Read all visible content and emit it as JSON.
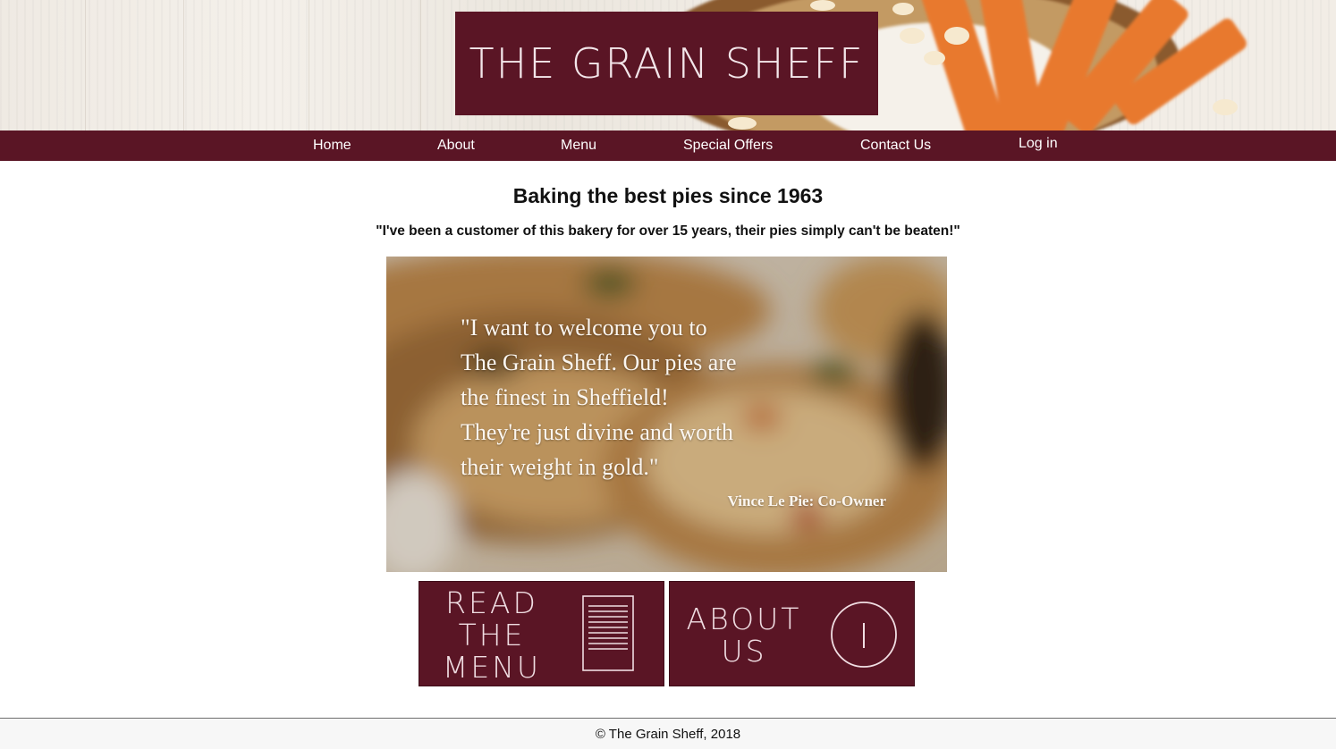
{
  "header": {
    "logo_text": "The Grain Sheff"
  },
  "nav": {
    "items": [
      {
        "label": "Home"
      },
      {
        "label": "About"
      },
      {
        "label": "Menu"
      },
      {
        "label": "Special Offers"
      },
      {
        "label": "Contact Us"
      },
      {
        "label": "Log in"
      }
    ]
  },
  "main": {
    "headline": "Baking the best pies since 1963",
    "testimonial": "\"I've been a customer of this bakery for over 15 years, their pies simply can't be beaten!\"",
    "hero": {
      "quote_lines": [
        "\"I want to welcome you to",
        "The Grain Sheff. Our pies are",
        "the finest in Sheffield!",
        "They're just divine and worth",
        "their weight in gold.\""
      ],
      "author": "Vince Le Pie: Co-Owner"
    },
    "tiles": {
      "menu": {
        "lines": [
          "Read",
          "the",
          "Menu"
        ],
        "icon": "document-icon"
      },
      "about": {
        "lines": [
          "About",
          "Us"
        ],
        "icon": "info-icon"
      }
    }
  },
  "footer": {
    "text": "© The Grain Sheff, 2018"
  },
  "colors": {
    "brand": "#5a1525",
    "nav_text": "#ffffff",
    "background": "#ffffff"
  }
}
